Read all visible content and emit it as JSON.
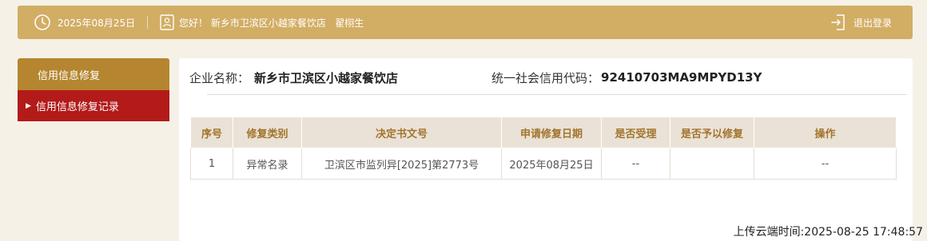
{
  "topbar": {
    "date": "2025年08月25日",
    "greeting": "您好！ 新乡市卫滨区小越家餐饮店   翟栩生",
    "logout_label": "退出登录"
  },
  "sidebar": {
    "header": "信用信息修复",
    "items": [
      {
        "label": "信用信息修复记录",
        "active": true
      }
    ]
  },
  "company": {
    "name_label": "企业名称：",
    "name": "新乡市卫滨区小越家餐饮店",
    "code_label": "统一社会信用代码：",
    "code": "92410703MA9MPYD13Y"
  },
  "table": {
    "headers": [
      "序号",
      "修复类别",
      "决定书文号",
      "申请修复日期",
      "是否受理",
      "是否予以修复",
      "操作"
    ],
    "rows": [
      [
        "1",
        "异常名录",
        "卫滨区市监列异[2025]第2773号",
        "2025年08月25日",
        "--",
        "",
        "--"
      ]
    ]
  },
  "footer": {
    "upload_time": "上传云端时间:2025-08-25 17:48:57"
  },
  "colors": {
    "topbar": "#d2ad64",
    "sidebar_header": "#b5862f",
    "sidebar_active": "#b31a1a",
    "table_header_bg": "#eae2d6",
    "table_header_text": "#a2742d",
    "page_bg": "#f6f1e7"
  },
  "icons": [
    "clock-icon",
    "user-id-icon",
    "logout-icon"
  ]
}
